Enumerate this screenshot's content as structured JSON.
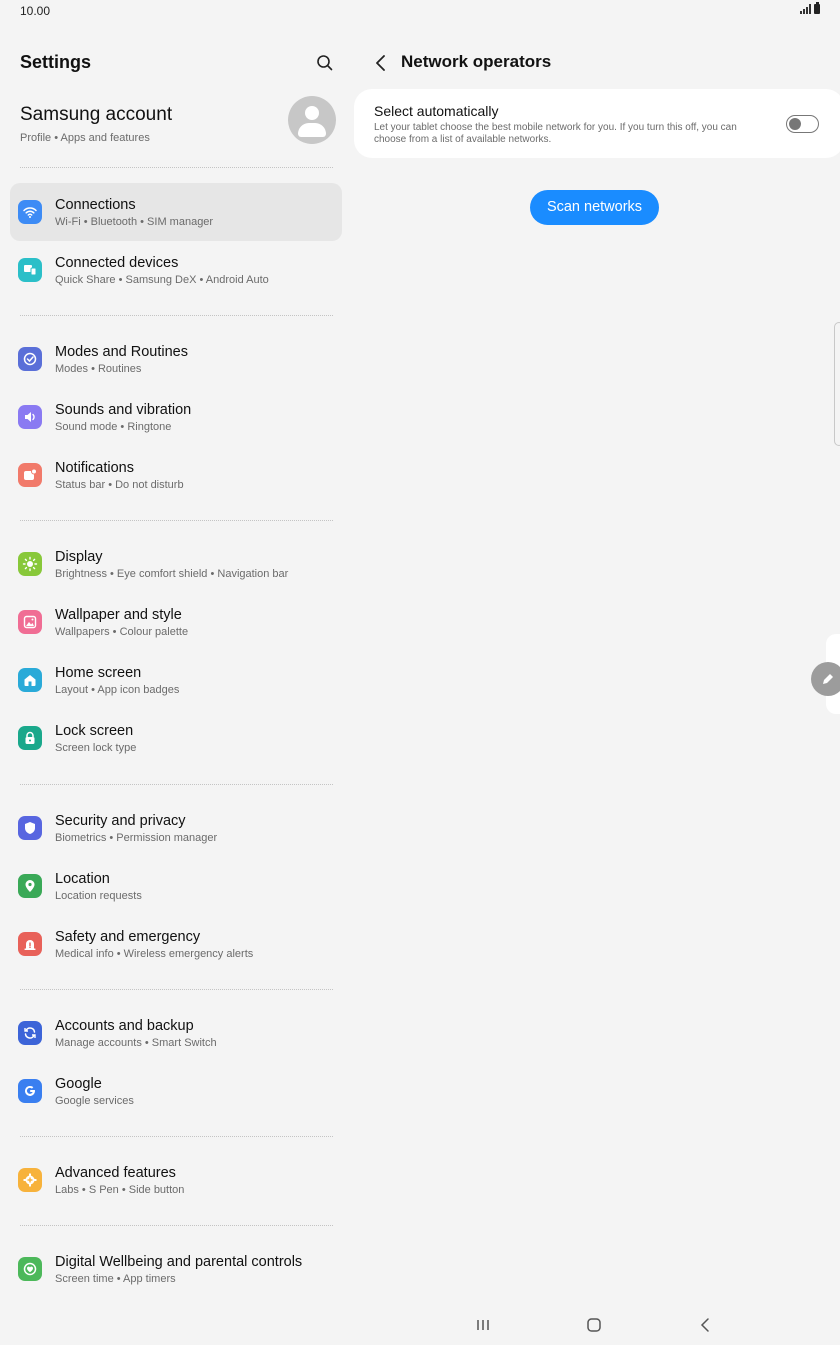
{
  "status_bar": {
    "time": "10.00"
  },
  "left": {
    "title": "Settings",
    "account": {
      "name": "Samsung account",
      "sub": "Profile  •  Apps and features"
    },
    "items": [
      {
        "title": "Connections",
        "sub": "Wi-Fi  •  Bluetooth  •  SIM manager",
        "color": "#3d8bf5",
        "icon": "wifi-icon",
        "selected": true
      },
      {
        "title": "Connected devices",
        "sub": "Quick Share  •  Samsung DeX  •  Android Auto",
        "color": "#2bbfc8",
        "icon": "devices-icon"
      },
      {
        "title": "Modes and Routines",
        "sub": "Modes  •  Routines",
        "color": "#5a6fd8",
        "icon": "check-circle-icon"
      },
      {
        "title": "Sounds and vibration",
        "sub": "Sound mode  •  Ringtone",
        "color": "#8a7af2",
        "icon": "speaker-icon"
      },
      {
        "title": "Notifications",
        "sub": "Status bar  •  Do not disturb",
        "color": "#f17a6a",
        "icon": "notification-icon"
      },
      {
        "title": "Display",
        "sub": "Brightness  •  Eye comfort shield  •  Navigation bar",
        "color": "#88c83a",
        "icon": "sun-icon"
      },
      {
        "title": "Wallpaper and style",
        "sub": "Wallpapers  •  Colour palette",
        "color": "#f06d94",
        "icon": "image-icon"
      },
      {
        "title": "Home screen",
        "sub": "Layout  •  App icon badges",
        "color": "#2aaad8",
        "icon": "home-icon"
      },
      {
        "title": "Lock screen",
        "sub": "Screen lock type",
        "color": "#1aa88b",
        "icon": "lock-icon"
      },
      {
        "title": "Security and privacy",
        "sub": "Biometrics  •  Permission manager",
        "color": "#5866e0",
        "icon": "shield-icon"
      },
      {
        "title": "Location",
        "sub": "Location requests",
        "color": "#3aa957",
        "icon": "location-pin-icon"
      },
      {
        "title": "Safety and emergency",
        "sub": "Medical info  •  Wireless emergency alerts",
        "color": "#e86159",
        "icon": "alert-icon"
      },
      {
        "title": "Accounts and backup",
        "sub": "Manage accounts  •  Smart Switch",
        "color": "#3c64d8",
        "icon": "sync-icon"
      },
      {
        "title": "Google",
        "sub": "Google services",
        "color": "#3a7ff0",
        "icon": "google-icon"
      },
      {
        "title": "Advanced features",
        "sub": "Labs  •  S Pen  •  Side button",
        "color": "#f7b23b",
        "icon": "gear-plus-icon"
      },
      {
        "title": "Digital Wellbeing and parental controls",
        "sub": "Screen time  •  App timers",
        "color": "#4cb85a",
        "icon": "wellbeing-icon"
      }
    ]
  },
  "right": {
    "title": "Network operators",
    "select_automatically": {
      "title": "Select automatically",
      "description": "Let your tablet choose the best mobile network for you. If you turn this off, you can choose from a list of available networks.",
      "enabled": false
    },
    "scan_button": "Scan networks"
  }
}
